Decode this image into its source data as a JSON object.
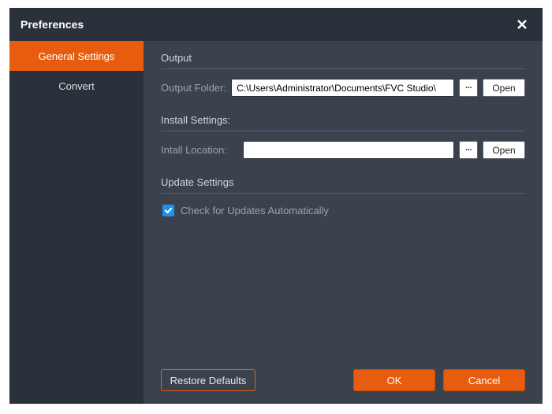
{
  "dialog": {
    "title": "Preferences"
  },
  "sidebar": {
    "tabs": [
      {
        "label": "General Settings",
        "active": true
      },
      {
        "label": "Convert",
        "active": false
      }
    ]
  },
  "sections": {
    "output": {
      "title": "Output",
      "folder_label": "Output Folder:",
      "folder_value": "C:\\Users\\Administrator\\Documents\\FVC Studio\\",
      "browse_label": "···",
      "open_label": "Open"
    },
    "install": {
      "title": "Install Settings:",
      "location_label": "Intall Location:",
      "location_value": "",
      "browse_label": "···",
      "open_label": "Open"
    },
    "update": {
      "title": "Update Settings",
      "check_label": "Check for Updates Automatically",
      "checked": true
    }
  },
  "footer": {
    "restore": "Restore Defaults",
    "ok": "OK",
    "cancel": "Cancel"
  }
}
